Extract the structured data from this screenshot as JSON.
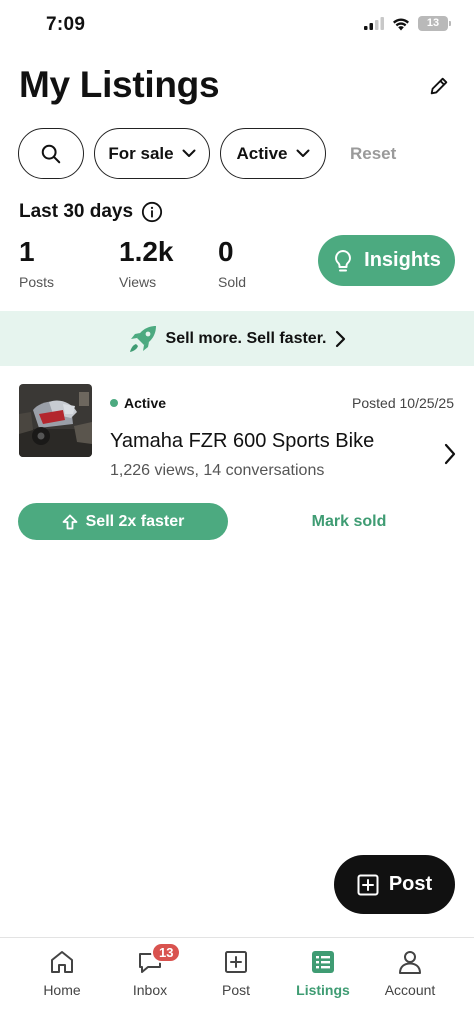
{
  "status_bar": {
    "time": "7:09",
    "battery": "13"
  },
  "header": {
    "title": "My Listings"
  },
  "filters": {
    "type_label": "For sale",
    "status_label": "Active",
    "reset_label": "Reset"
  },
  "stats": {
    "period": "Last 30 days",
    "posts": {
      "value": "1",
      "label": "Posts"
    },
    "views": {
      "value": "1.2k",
      "label": "Views"
    },
    "sold": {
      "value": "0",
      "label": "Sold"
    },
    "insights_label": "Insights"
  },
  "promo": {
    "text": "Sell more. Sell faster."
  },
  "listing": {
    "status": "Active",
    "posted": "Posted 10/25/25",
    "title": "Yamaha FZR 600 Sports Bike",
    "meta": "1,226 views, 14 conversations",
    "boost_label": "Sell 2x faster",
    "mark_sold_label": "Mark sold"
  },
  "fab": {
    "label": "Post"
  },
  "tabbar": {
    "items": [
      {
        "label": "Home",
        "icon": "home-icon"
      },
      {
        "label": "Inbox",
        "icon": "chat-icon",
        "badge": "13"
      },
      {
        "label": "Post",
        "icon": "plus-square-icon"
      },
      {
        "label": "Listings",
        "icon": "list-icon"
      },
      {
        "label": "Account",
        "icon": "person-icon"
      }
    ],
    "selected": "Listings"
  },
  "colors": {
    "accent": "#4caa80",
    "accent_text": "#3f9c73",
    "promo_bg": "#e6f4ee",
    "badge": "#d9534f"
  }
}
